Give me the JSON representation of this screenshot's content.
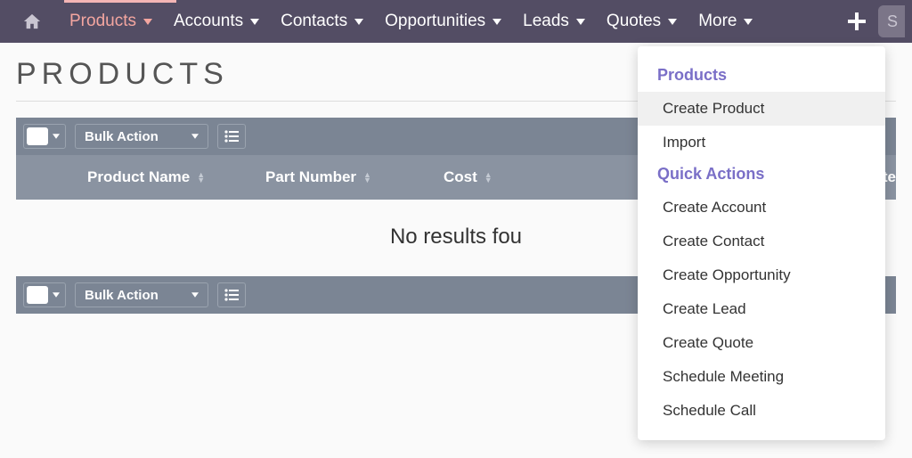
{
  "nav": {
    "items": [
      {
        "label": "Products",
        "active": true
      },
      {
        "label": "Accounts"
      },
      {
        "label": "Contacts"
      },
      {
        "label": "Opportunities"
      },
      {
        "label": "Leads"
      },
      {
        "label": "Quotes"
      },
      {
        "label": "More"
      }
    ]
  },
  "search": {
    "placeholder": "S"
  },
  "page": {
    "title": "PRODUCTS"
  },
  "toolbar": {
    "bulk_action_label": "Bulk Action"
  },
  "table": {
    "columns": {
      "product_name": "Product Name",
      "part_number": "Part Number",
      "cost": "Cost",
      "category_partial": "Cate"
    },
    "empty_text": "No results fou"
  },
  "dropdown": {
    "section1_title": "Products",
    "section1_items": [
      {
        "label": "Create Product",
        "hover": true
      },
      {
        "label": "Import"
      }
    ],
    "section2_title": "Quick Actions",
    "section2_items": [
      {
        "label": "Create Account"
      },
      {
        "label": "Create Contact"
      },
      {
        "label": "Create Opportunity"
      },
      {
        "label": "Create Lead"
      },
      {
        "label": "Create Quote"
      },
      {
        "label": "Schedule Meeting"
      },
      {
        "label": "Schedule Call"
      }
    ]
  }
}
